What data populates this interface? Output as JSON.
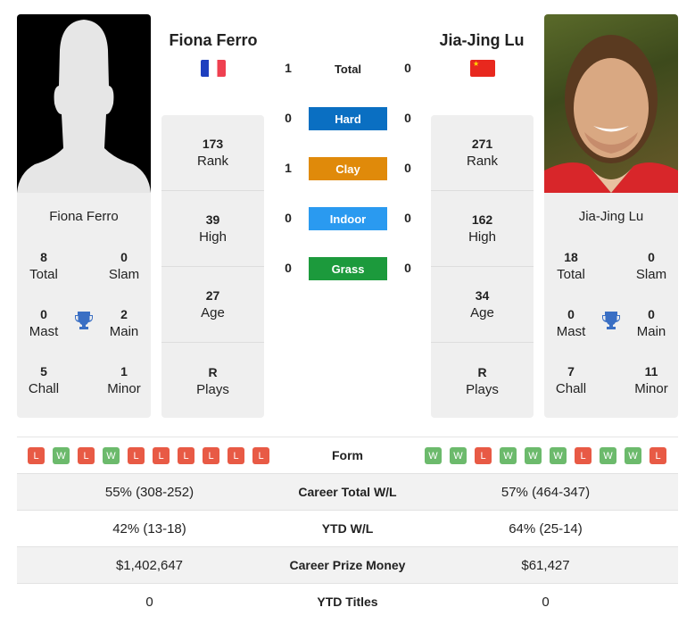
{
  "h2h": {
    "rows": [
      {
        "label": "Total",
        "left": "1",
        "right": "0",
        "color": ""
      },
      {
        "label": "Hard",
        "left": "0",
        "right": "0",
        "color": "#0a6fc2"
      },
      {
        "label": "Clay",
        "left": "1",
        "right": "0",
        "color": "#e08a0a"
      },
      {
        "label": "Indoor",
        "left": "0",
        "right": "0",
        "color": "#2a9af0"
      },
      {
        "label": "Grass",
        "left": "0",
        "right": "0",
        "color": "#1c9a3c"
      }
    ]
  },
  "player1": {
    "name": "Fiona Ferro",
    "flag": "France",
    "photo": "silhouette-placeholder",
    "titles": {
      "total": "8",
      "total_label": "Total",
      "slam": "0",
      "slam_label": "Slam",
      "mast": "0",
      "mast_label": "Mast",
      "main": "2",
      "main_label": "Main",
      "chall": "5",
      "chall_label": "Chall",
      "minor": "1",
      "minor_label": "Minor"
    },
    "stats": [
      {
        "value": "173",
        "label": "Rank"
      },
      {
        "value": "39",
        "label": "High"
      },
      {
        "value": "27",
        "label": "Age"
      },
      {
        "value": "R",
        "label": "Plays"
      }
    ],
    "form": [
      "L",
      "W",
      "L",
      "W",
      "L",
      "L",
      "L",
      "L",
      "L",
      "L"
    ]
  },
  "player2": {
    "name": "Jia-Jing Lu",
    "flag": "China",
    "photo": "player-photo",
    "titles": {
      "total": "18",
      "total_label": "Total",
      "slam": "0",
      "slam_label": "Slam",
      "mast": "0",
      "mast_label": "Mast",
      "main": "0",
      "main_label": "Main",
      "chall": "7",
      "chall_label": "Chall",
      "minor": "11",
      "minor_label": "Minor"
    },
    "stats": [
      {
        "value": "271",
        "label": "Rank"
      },
      {
        "value": "162",
        "label": "High"
      },
      {
        "value": "34",
        "label": "Age"
      },
      {
        "value": "R",
        "label": "Plays"
      }
    ],
    "form": [
      "W",
      "W",
      "L",
      "W",
      "W",
      "W",
      "L",
      "W",
      "W",
      "L"
    ]
  },
  "form_label": "Form",
  "comparison": [
    {
      "label": "Career Total W/L",
      "left": "55% (308-252)",
      "right": "57% (464-347)"
    },
    {
      "label": "YTD W/L",
      "left": "42% (13-18)",
      "right": "64% (25-14)"
    },
    {
      "label": "Career Prize Money",
      "left": "$1,402,647",
      "right": "$61,427"
    },
    {
      "label": "YTD Titles",
      "left": "0",
      "right": "0"
    }
  ]
}
